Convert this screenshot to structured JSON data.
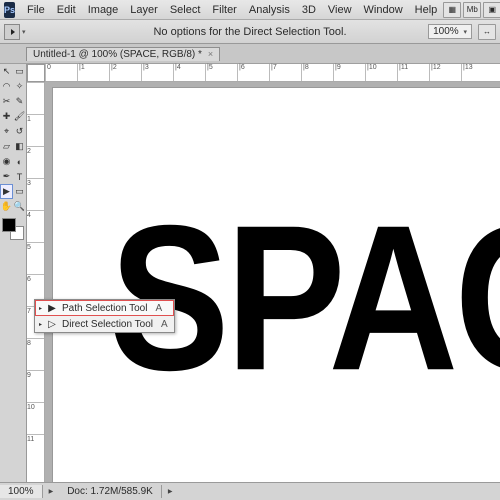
{
  "menubar": {
    "items": [
      "File",
      "Edit",
      "Image",
      "Layer",
      "Select",
      "Filter",
      "Analysis",
      "3D",
      "View",
      "Window",
      "Help"
    ],
    "tray": [
      "▦",
      "Mb",
      "▣",
      "▤"
    ]
  },
  "options_bar": {
    "message": "No options for the Direct Selection Tool.",
    "zoom_menu_label": "100%",
    "zoom_caret": "▾"
  },
  "document_tab": {
    "title": "Untitled-1 @ 100% (SPACE, RGB/8) *",
    "close": "×"
  },
  "ruler_top": [
    "0",
    "|1",
    "|2",
    "|3",
    "|4",
    "|5",
    "|6",
    "|7",
    "|8",
    "|9",
    "|10",
    "|11",
    "|12",
    "|13"
  ],
  "ruler_left": [
    "",
    "1",
    "2",
    "3",
    "4",
    "5",
    "6",
    "7",
    "8",
    "9",
    "10",
    "11"
  ],
  "canvas": {
    "text": "SPACE"
  },
  "toolbox": {
    "rows": [
      [
        "move",
        "marquee"
      ],
      [
        "lasso",
        "quick-select"
      ],
      [
        "crop",
        "eyedropper"
      ],
      [
        "spot-heal",
        "brush"
      ],
      [
        "clone",
        "history-brush"
      ],
      [
        "eraser",
        "gradient"
      ],
      [
        "blur",
        "dodge"
      ],
      [
        "pen",
        "type"
      ],
      [
        "path-sel",
        "rectangle"
      ],
      [
        "hand",
        "zoom"
      ]
    ],
    "glyphs": {
      "move": "↖",
      "marquee": "▭",
      "lasso": "◠",
      "quick-select": "✧",
      "crop": "✂",
      "eyedropper": "✎",
      "spot-heal": "✚",
      "brush": "🖌",
      "clone": "⌖",
      "history-brush": "↺",
      "eraser": "▱",
      "gradient": "◧",
      "blur": "◉",
      "dodge": "◐",
      "pen": "✒",
      "type": "T",
      "path-sel": "▶",
      "rectangle": "▭",
      "hand": "✋",
      "zoom": "🔍"
    }
  },
  "flyout": {
    "items": [
      {
        "icon": "▶",
        "label": "Path Selection Tool",
        "key": "A",
        "selected": true
      },
      {
        "icon": "▷",
        "label": "Direct Selection Tool",
        "key": "A",
        "selected": false
      }
    ],
    "tri": "▸"
  },
  "statusbar": {
    "zoom": "100%",
    "doc": "Doc: 1.72M/585.9K",
    "tri": "▶"
  }
}
